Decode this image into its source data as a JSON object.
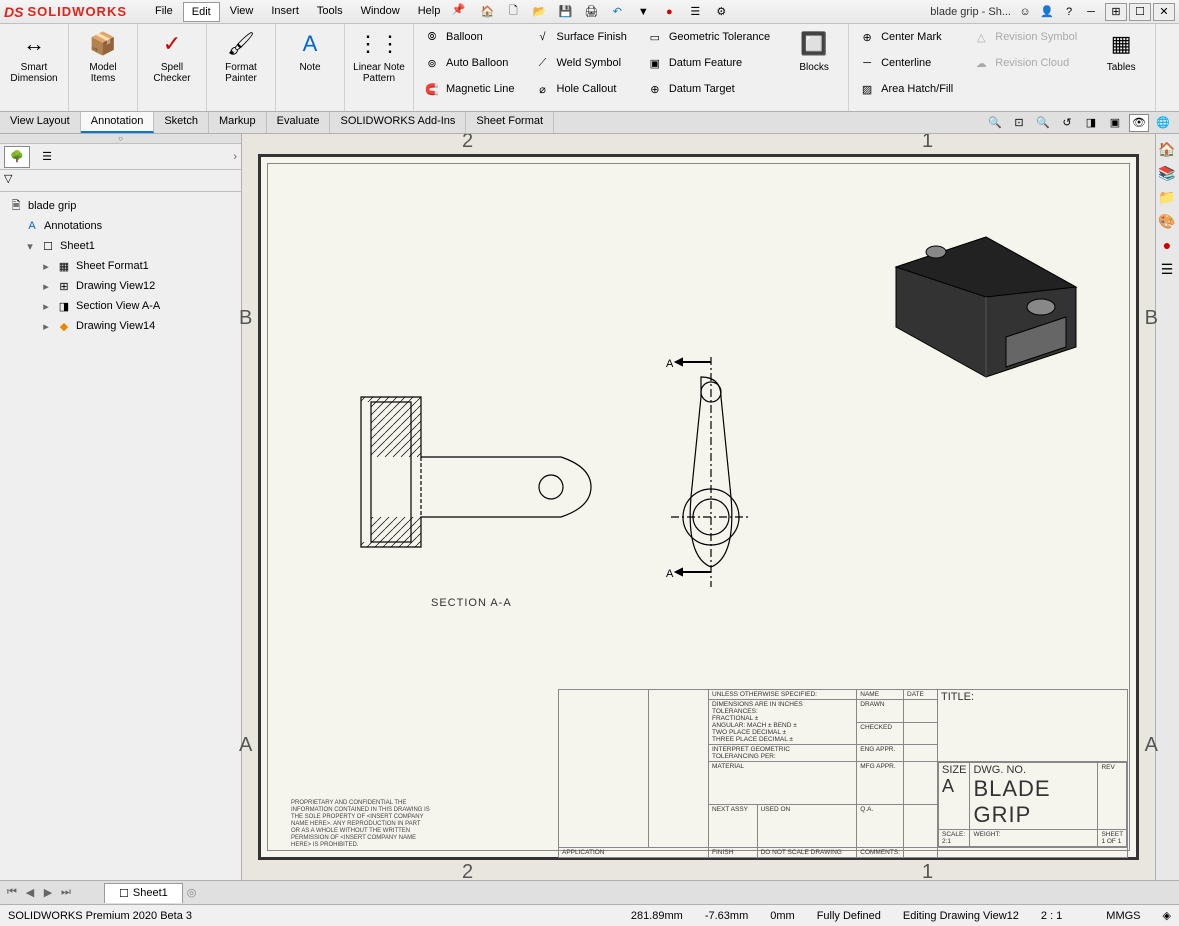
{
  "logo": {
    "ds": "DS",
    "text": "SOLIDWORKS"
  },
  "menu": [
    "File",
    "Edit",
    "View",
    "Insert",
    "Tools",
    "Window",
    "Help"
  ],
  "menu_selected_index": 1,
  "document_title": "blade grip - Sh...",
  "ribbon": {
    "big": [
      {
        "label": "Smart\nDimension"
      },
      {
        "label": "Model\nItems"
      },
      {
        "label": "Spell\nChecker"
      },
      {
        "label": "Format\nPainter"
      },
      {
        "label": "Note"
      },
      {
        "label": "Linear Note\nPattern"
      }
    ],
    "col1": [
      "Balloon",
      "Auto Balloon",
      "Magnetic Line"
    ],
    "col2": [
      "Surface Finish",
      "Weld Symbol",
      "Hole Callout"
    ],
    "col3": [
      "Geometric Tolerance",
      "Datum Feature",
      "Datum Target"
    ],
    "blocks": "Blocks",
    "col4": [
      "Center Mark",
      "Centerline",
      "Area Hatch/Fill"
    ],
    "col5_disabled": [
      "Revision Symbol",
      "Revision Cloud"
    ],
    "tables": "Tables"
  },
  "tabs": [
    "View Layout",
    "Annotation",
    "Sketch",
    "Markup",
    "Evaluate",
    "SOLIDWORKS Add-Ins",
    "Sheet Format"
  ],
  "active_tab": 1,
  "tree": {
    "root": "blade grip",
    "annotations": "Annotations",
    "sheet": "Sheet1",
    "children": [
      "Sheet Format1",
      "Drawing View12",
      "Section View A-A",
      "Drawing View14"
    ]
  },
  "drawing": {
    "zones_h": [
      "2",
      "1"
    ],
    "zones_v": [
      "B",
      "A"
    ],
    "section_label": "SECTION A-A",
    "section_mark": "A"
  },
  "titleblock": {
    "unless": "UNLESS OTHERWISE SPECIFIED:",
    "diminfo": "DIMENSIONS ARE IN INCHES\nTOLERANCES:\nFRACTIONAL ±\nANGULAR: MACH ±   BEND ±\nTWO PLACE DECIMAL   ±\nTHREE PLACE DECIMAL ±",
    "interpret": "INTERPRET GEOMETRIC\nTOLERANCING PER:",
    "material": "MATERIAL",
    "finish": "FINISH",
    "donotscale": "DO NOT SCALE DRAWING",
    "name": "NAME",
    "date": "DATE",
    "rows": [
      "DRAWN",
      "CHECKED",
      "ENG APPR.",
      "MFG APPR.",
      "Q.A.",
      "COMMENTS:"
    ],
    "title": "TITLE:",
    "size": "SIZE",
    "size_val": "A",
    "dwgno": "DWG.  NO.",
    "dwgno_val": "blade grip",
    "rev": "REV",
    "scale": "SCALE: 2:1",
    "weight": "WEIGHT:",
    "sheet": "SHEET 1 OF 1",
    "nextassy": "NEXT ASSY",
    "usedon": "USED ON",
    "application": "APPLICATION"
  },
  "proprietary": "PROPRIETARY AND CONFIDENTIAL\nTHE INFORMATION CONTAINED IN THIS DRAWING IS THE SOLE PROPERTY OF <INSERT COMPANY NAME HERE>. ANY REPRODUCTION IN PART OR AS A WHOLE WITHOUT THE WRITTEN PERMISSION OF <INSERT COMPANY NAME HERE> IS PROHIBITED.",
  "mdi_tab": "Sheet1",
  "statusbar": {
    "product": "SOLIDWORKS Premium 2020 Beta 3",
    "x": "281.89mm",
    "y": "-7.63mm",
    "z": "0mm",
    "def": "Fully Defined",
    "editing": "Editing Drawing View12",
    "zoom": "2 : 1",
    "units": "MMGS"
  }
}
